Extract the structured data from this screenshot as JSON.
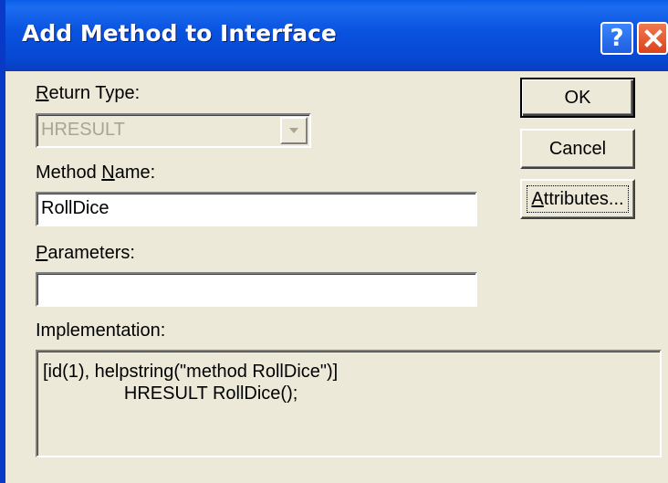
{
  "window": {
    "title": "Add Method to Interface",
    "help_glyph": "?",
    "close_icon": "close-icon",
    "title_color": "#0a39c8",
    "dialog_bg": "#ece9d8"
  },
  "form": {
    "return_type": {
      "label_prefix": "",
      "label_access": "R",
      "label_rest": "eturn Type:",
      "value": "HRESULT",
      "disabled": true
    },
    "method_name": {
      "label_prefix": "Method ",
      "label_access": "N",
      "label_rest": "ame:",
      "value": "RollDice"
    },
    "parameters": {
      "label_prefix": "",
      "label_access": "P",
      "label_rest": "arameters:",
      "value": ""
    },
    "implementation": {
      "label": "Implementation:",
      "line1": "[id(1), helpstring(\"method RollDice\")]",
      "line2": "                HRESULT RollDice();"
    }
  },
  "buttons": {
    "ok": "OK",
    "cancel": "Cancel",
    "attributes_access": "A",
    "attributes_rest": "ttributes..."
  }
}
